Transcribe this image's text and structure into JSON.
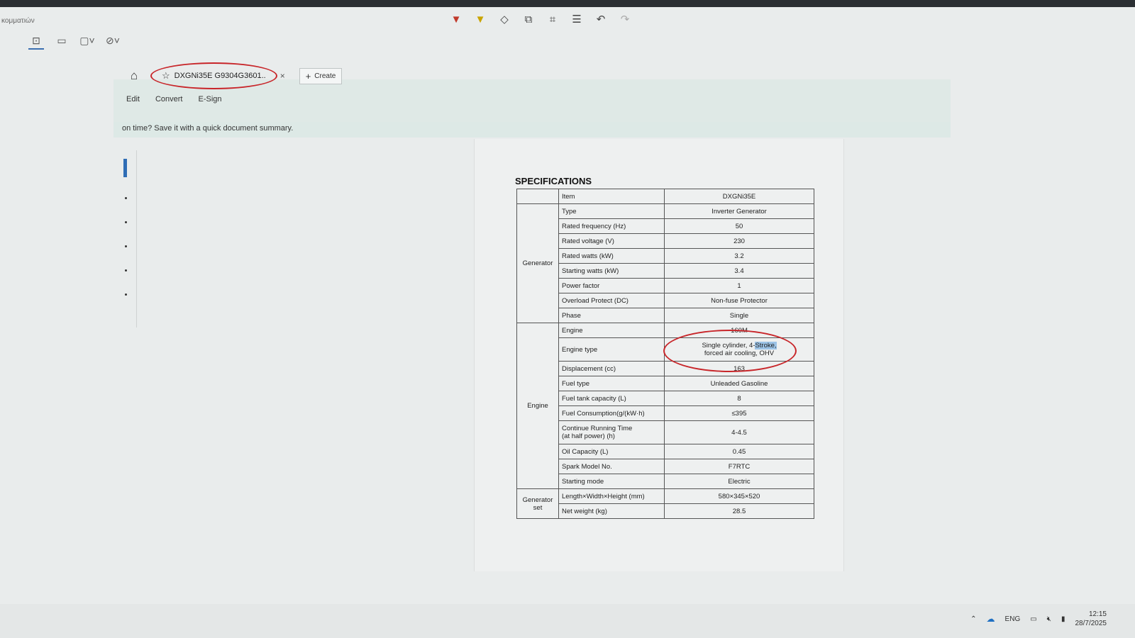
{
  "capture_title": "κομματιών",
  "snip_tools": [
    {
      "name": "camera-icon",
      "glyph": "⊡"
    },
    {
      "name": "video-icon",
      "glyph": "▭"
    },
    {
      "name": "rect-select-icon",
      "glyph": "▢˅"
    },
    {
      "name": "no-timer-icon",
      "glyph": "⊘˅"
    }
  ],
  "markup_tools": [
    {
      "name": "red-pen-icon",
      "glyph": "▼"
    },
    {
      "name": "highlighter-icon",
      "glyph": "▼"
    },
    {
      "name": "eraser-icon",
      "glyph": "◇"
    },
    {
      "name": "shapes-icon",
      "glyph": "⧉"
    },
    {
      "name": "crop-icon",
      "glyph": "⌗"
    },
    {
      "name": "text-extract-icon",
      "glyph": "☰"
    },
    {
      "name": "undo-icon",
      "glyph": "↶"
    },
    {
      "name": "redo-icon",
      "glyph": "↷"
    }
  ],
  "tab": {
    "title": "DXGNi35E G9304G3601..",
    "create_label": "Create"
  },
  "menu": [
    "Edit",
    "Convert",
    "E-Sign"
  ],
  "infobar_text": "on time? Save it with a quick document summary.",
  "spec": {
    "title": "SPECIFICATIONS",
    "header": {
      "item": "Item",
      "model": "DXGNi35E"
    },
    "groups": {
      "generator": "Generator",
      "engine": "Engine",
      "set_line1": "Generator",
      "set_line2": "set"
    },
    "rows": [
      {
        "item": "Type",
        "value": "Inverter Generator"
      },
      {
        "item": "Rated frequency (Hz)",
        "value": "50"
      },
      {
        "item": "Rated voltage (V)",
        "value": "230"
      },
      {
        "item": "Rated watts (kW)",
        "value": "3.2"
      },
      {
        "item": "Starting watts (kW)",
        "value": "3.4"
      },
      {
        "item": "Power factor",
        "value": "1"
      },
      {
        "item": "Overload Protect (DC)",
        "value": "Non-fuse Protector"
      },
      {
        "item": "Phase",
        "value": "Single"
      },
      {
        "item": "Engine",
        "value": "160M"
      },
      {
        "item": "Engine type",
        "value_line1": "Single cylinder, 4-",
        "value_highlight": "Stroke,",
        "value_line2": "forced air cooling, OHV"
      },
      {
        "item": "Displacement (cc)",
        "value": "163"
      },
      {
        "item": "Fuel type",
        "value": "Unleaded Gasoline"
      },
      {
        "item": "Fuel tank capacity (L)",
        "value": "8"
      },
      {
        "item": "Fuel Consumption(g/(kW·h)",
        "value": "≤395"
      },
      {
        "item_line1": "Continue Running Time",
        "item_line2": "(at half power) (h)",
        "value": "4-4.5"
      },
      {
        "item": "Oil Capacity (L)",
        "value": "0.45"
      },
      {
        "item": "Spark Model No.",
        "value": "F7RTC"
      },
      {
        "item": "Starting mode",
        "value": "Electric"
      },
      {
        "item": "Length×Width×Height (mm)",
        "value": "580×345×520"
      },
      {
        "item": "Net weight (kg)",
        "value": "28.5"
      }
    ]
  },
  "tray": {
    "lang": "ENG",
    "time": "12:15",
    "date": "28/7/2025"
  }
}
